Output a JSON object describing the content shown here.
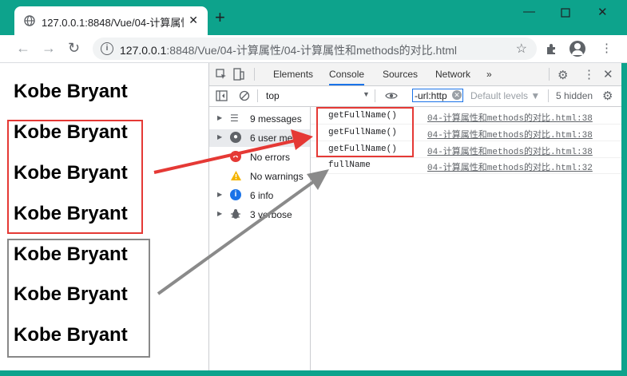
{
  "browser": {
    "tab_title": "127.0.0.1:8848/Vue/04-计算属性",
    "new_tab": "+",
    "url_host": "127.0.0.1",
    "url_path": ":8848/Vue/04-计算属性/04-计算属性和methods的对比.html"
  },
  "page": {
    "names": [
      "Kobe Bryant",
      "Kobe Bryant",
      "Kobe Bryant",
      "Kobe Bryant",
      "Kobe Bryant",
      "Kobe Bryant",
      "Kobe Bryant"
    ]
  },
  "devtools": {
    "tabs": [
      "Elements",
      "Console",
      "Sources",
      "Network",
      "»"
    ],
    "active_tab": "Console",
    "context": "top",
    "filter_value": "-url:http",
    "levels": "Default levels ▼",
    "hidden": "5 hidden",
    "sidebar": [
      {
        "label": "9 messages",
        "icon": "list-icon"
      },
      {
        "label": "6 user me",
        "icon": "user-icon"
      },
      {
        "label": "No errors",
        "icon": "error-icon"
      },
      {
        "label": "No warnings",
        "icon": "warning-icon"
      },
      {
        "label": "6 info",
        "icon": "info-icon"
      },
      {
        "label": "3 verbose",
        "icon": "bug-icon"
      }
    ],
    "logs": [
      {
        "msg": "getFullName()",
        "src": "04-计算属性和methods的对比.html:38"
      },
      {
        "msg": "getFullName()",
        "src": "04-计算属性和methods的对比.html:38"
      },
      {
        "msg": "getFullName()",
        "src": "04-计算属性和methods的对比.html:38"
      },
      {
        "msg": "fullName",
        "src": "04-计算属性和methods的对比.html:32"
      }
    ]
  },
  "colors": {
    "chrome": "#0da38c",
    "highlight_red": "#e53935",
    "highlight_gray": "#888888"
  }
}
